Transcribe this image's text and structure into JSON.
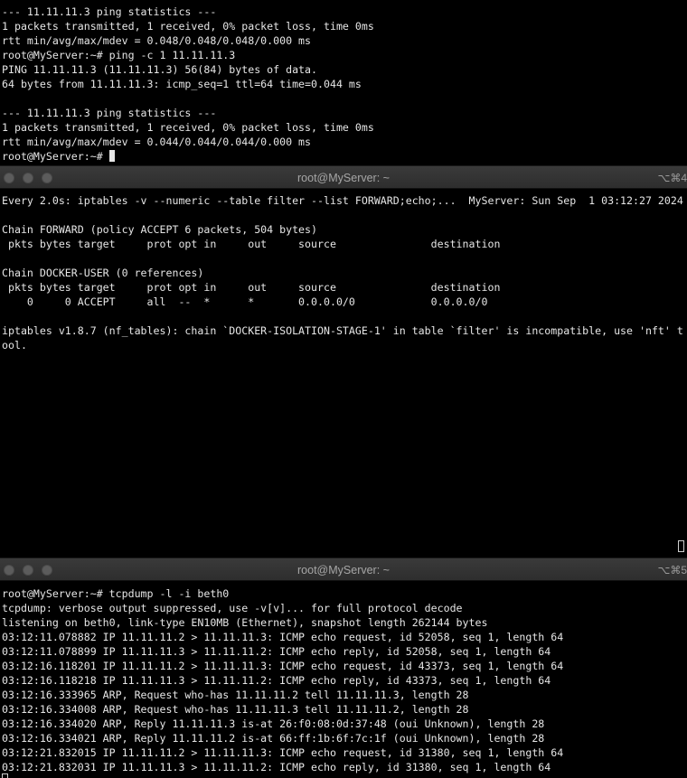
{
  "pane1": {
    "lines": [
      "--- 11.11.11.3 ping statistics ---",
      "1 packets transmitted, 1 received, 0% packet loss, time 0ms",
      "rtt min/avg/max/mdev = 0.048/0.048/0.048/0.000 ms",
      "root@MyServer:~# ping -c 1 11.11.11.3",
      "PING 11.11.11.3 (11.11.11.3) 56(84) bytes of data.",
      "64 bytes from 11.11.11.3: icmp_seq=1 ttl=64 time=0.044 ms",
      "",
      "--- 11.11.11.3 ping statistics ---",
      "1 packets transmitted, 1 received, 0% packet loss, time 0ms",
      "rtt min/avg/max/mdev = 0.044/0.044/0.044/0.000 ms"
    ],
    "prompt": "root@MyServer:~# "
  },
  "window2": {
    "title": "root@MyServer: ~",
    "shortcut": "⌥⌘4"
  },
  "pane2": {
    "lines": [
      "Every 2.0s: iptables -v --numeric --table filter --list FORWARD;echo;...  MyServer: Sun Sep  1 03:12:27 2024",
      "",
      "Chain FORWARD (policy ACCEPT 6 packets, 504 bytes)",
      " pkts bytes target     prot opt in     out     source               destination",
      "",
      "Chain DOCKER-USER (0 references)",
      " pkts bytes target     prot opt in     out     source               destination",
      "    0     0 ACCEPT     all  --  *      *       0.0.0.0/0            0.0.0.0/0",
      "",
      "iptables v1.8.7 (nf_tables): chain `DOCKER-ISOLATION-STAGE-1' in table `filter' is incompatible, use 'nft' t",
      "ool."
    ]
  },
  "window3": {
    "title": "root@MyServer: ~",
    "shortcut": "⌥⌘5"
  },
  "pane3": {
    "lines": [
      "root@MyServer:~# tcpdump -l -i beth0",
      "tcpdump: verbose output suppressed, use -v[v]... for full protocol decode",
      "listening on beth0, link-type EN10MB (Ethernet), snapshot length 262144 bytes",
      "03:12:11.078882 IP 11.11.11.2 > 11.11.11.3: ICMP echo request, id 52058, seq 1, length 64",
      "03:12:11.078899 IP 11.11.11.3 > 11.11.11.2: ICMP echo reply, id 52058, seq 1, length 64",
      "03:12:16.118201 IP 11.11.11.2 > 11.11.11.3: ICMP echo request, id 43373, seq 1, length 64",
      "03:12:16.118218 IP 11.11.11.3 > 11.11.11.2: ICMP echo reply, id 43373, seq 1, length 64",
      "03:12:16.333965 ARP, Request who-has 11.11.11.2 tell 11.11.11.3, length 28",
      "03:12:16.334008 ARP, Request who-has 11.11.11.3 tell 11.11.11.2, length 28",
      "03:12:16.334020 ARP, Reply 11.11.11.3 is-at 26:f0:08:0d:37:48 (oui Unknown), length 28",
      "03:12:16.334021 ARP, Reply 11.11.11.2 is-at 66:ff:1b:6f:7c:1f (oui Unknown), length 28",
      "03:12:21.832015 IP 11.11.11.2 > 11.11.11.3: ICMP echo request, id 31380, seq 1, length 64",
      "03:12:21.832031 IP 11.11.11.3 > 11.11.11.2: ICMP echo reply, id 31380, seq 1, length 64"
    ]
  }
}
